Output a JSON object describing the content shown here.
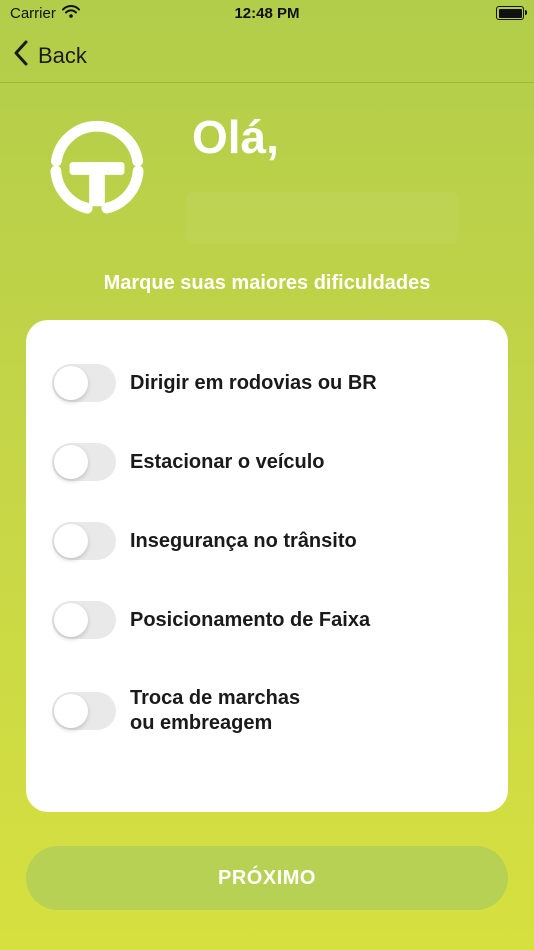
{
  "status_bar": {
    "carrier": "Carrier",
    "time": "12:48 PM",
    "battery_level": 1.0,
    "icons": [
      "wifi-icon",
      "battery-icon"
    ]
  },
  "nav": {
    "back_label": "Back",
    "back_icon": "chevron-left-icon"
  },
  "header": {
    "logo_icon": "steering-wheel-icon",
    "greeting": "Olá,"
  },
  "subtitle": "Marque suas maiores dificuldades",
  "options": [
    {
      "label": "Dirigir em rodovias ou BR",
      "checked": false
    },
    {
      "label": "Estacionar o veículo",
      "checked": false
    },
    {
      "label": "Insegurança no trânsito",
      "checked": false
    },
    {
      "label": "Posicionamento de Faixa",
      "checked": false
    },
    {
      "label": "Troca de marchas\nou embreagem",
      "checked": false
    }
  ],
  "next_button": {
    "label": "PRÓXIMO"
  },
  "colors": {
    "gradient_top": "#b2cd4a",
    "gradient_bottom": "#d6e03f",
    "button": "#b7d154",
    "toggle_off": "#e9e9ea"
  }
}
